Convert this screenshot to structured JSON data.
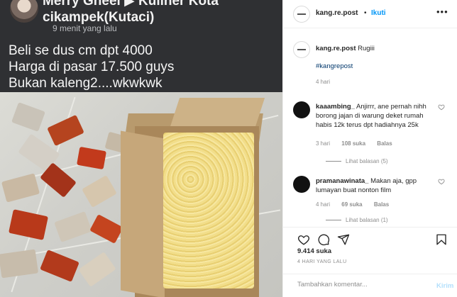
{
  "post_image": {
    "poster_name": "Merry Gheel ▶ Kuliner Kota cikampek(Kutaci)",
    "poster_time": "9 menit yang lalu",
    "lines": [
      "Beli se dus cm dpt 4000",
      "Harga di pasar 17.500 guys",
      "Bukan kaleng2....wkwkwk"
    ]
  },
  "header": {
    "username": "kang.re.post",
    "separator": "•",
    "follow_label": "Ikuti",
    "more_icon": "more-options-icon"
  },
  "caption": {
    "username": "kang.re.post",
    "text": "Rugiii",
    "hashtag": "#kangrepost",
    "time": "4 hari"
  },
  "comments": [
    {
      "username": "kaaambing_",
      "text": "Anjirrr, ane pernah nihh borong jajan di warung deket rumah habis 12k terus dpt hadiahnya 25k",
      "time": "3 hari",
      "likes": "108 suka",
      "reply_label": "Balas",
      "replies_label": "Lihat balasan (5)"
    },
    {
      "username": "pramanawinata_",
      "text": "Makan aja, gpp lumayan buat nonton film",
      "time": "4 hari",
      "likes": "69 suka",
      "reply_label": "Balas",
      "replies_label": "Lihat balasan (1)"
    }
  ],
  "actions": {
    "icons": [
      "heart-icon",
      "comment-icon",
      "share-icon",
      "bookmark-icon"
    ]
  },
  "likes": "9.414 suka",
  "post_time": "4 HARI YANG LALU",
  "composer": {
    "placeholder": "Tambahkan komentar...",
    "post_label": "Kirim"
  },
  "colors": {
    "accent": "#0095f6",
    "text": "#262626",
    "muted": "#8e8e8e",
    "hashtag": "#00376b"
  }
}
